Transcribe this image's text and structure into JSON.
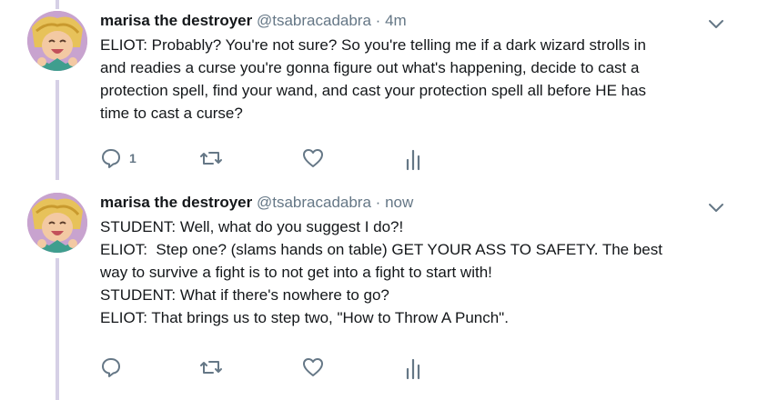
{
  "tweets": [
    {
      "name": "marisa the destroyer",
      "handle": "@tsabracadabra",
      "separator": "·",
      "time": "4m",
      "lines": [
        "ELIOT: Probably? You're not sure? So you're telling me if a dark wizard strolls in",
        "and readies a curse you're gonna figure out what's happening, decide to cast a",
        "protection spell, find your wand, and cast your protection spell all before HE has",
        "time to cast a curse?"
      ],
      "reply_count": "1",
      "icons": [
        "reply-icon",
        "retweet-icon",
        "like-icon",
        "analytics-icon",
        "chevron-down-icon"
      ]
    },
    {
      "name": "marisa the destroyer",
      "handle": "@tsabracadabra",
      "separator": "·",
      "time": "now",
      "lines": [
        "STUDENT: Well, what do you suggest I do?!",
        "ELIOT:  Step one? (slams hands on table) GET YOUR ASS TO SAFETY. The best",
        "way to survive a fight is to not get into a fight to start with!",
        "STUDENT: What if there's nowhere to go?",
        "ELIOT: That brings us to step two, \"How to Throw A Punch\"."
      ],
      "reply_count": "",
      "icons": [
        "reply-icon",
        "retweet-icon",
        "like-icon",
        "analytics-icon",
        "chevron-down-icon"
      ]
    }
  ],
  "colors": {
    "text": "#14171a",
    "secondary": "#657786",
    "thread_line": "#d6d0e6"
  }
}
